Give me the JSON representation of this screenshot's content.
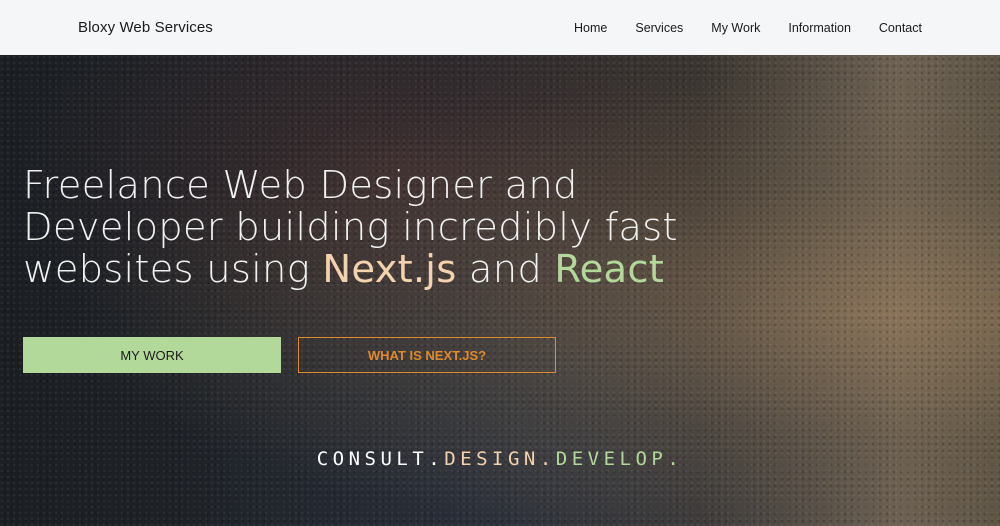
{
  "nav": {
    "brand": "Bloxy Web Services",
    "links": [
      "Home",
      "Services",
      "My Work",
      "Information",
      "Contact"
    ]
  },
  "hero": {
    "headline_prefix": "Freelance Web Designer and Developer building incredibly fast websites using",
    "highlight_next": "Next.js",
    "connector": "and",
    "highlight_react": "React",
    "primary_button": "MY WORK",
    "secondary_button": "WHAT IS NEXT.JS?",
    "tagline": {
      "part1": "CONSULT.",
      "part2": "DESIGN.",
      "part3": "DEVELOP."
    }
  },
  "colors": {
    "accent_green": "#b3d99a",
    "accent_peach": "#f4d2ae",
    "accent_orange": "#e08a2e",
    "nav_bg": "#f5f6f8"
  }
}
